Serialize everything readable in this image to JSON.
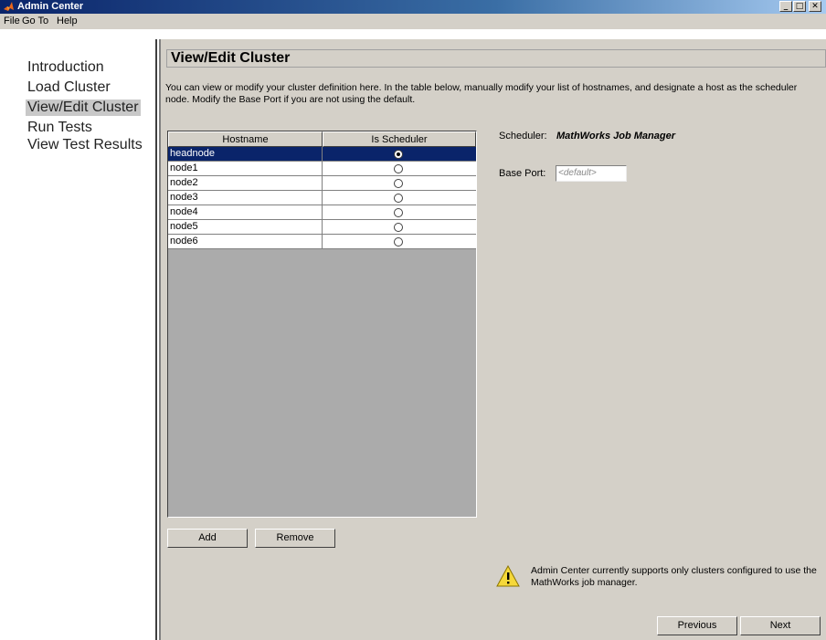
{
  "window": {
    "title": "Admin Center"
  },
  "menu": {
    "file": "File",
    "goto": "Go To",
    "help": "Help"
  },
  "nav": {
    "items": [
      {
        "label": "Introduction"
      },
      {
        "label": "Load Cluster"
      },
      {
        "label": "View/Edit Cluster",
        "active": true
      },
      {
        "label": "Run Tests"
      },
      {
        "label": "View Test Results"
      }
    ]
  },
  "page": {
    "title": "View/Edit Cluster",
    "description": "You can view or modify your cluster definition here. In the table below, manually modify your list of hostnames, and designate a host as the scheduler node. Modify the Base Port if you are not using the default."
  },
  "table": {
    "headers": {
      "hostname": "Hostname",
      "is_scheduler": "Is Scheduler"
    },
    "rows": [
      {
        "hostname": "headnode",
        "is_scheduler": true
      },
      {
        "hostname": "node1",
        "is_scheduler": false
      },
      {
        "hostname": "node2",
        "is_scheduler": false
      },
      {
        "hostname": "node3",
        "is_scheduler": false
      },
      {
        "hostname": "node4",
        "is_scheduler": false
      },
      {
        "hostname": "node5",
        "is_scheduler": false
      },
      {
        "hostname": "node6",
        "is_scheduler": false
      }
    ]
  },
  "buttons": {
    "add": "Add",
    "remove": "Remove",
    "previous": "Previous",
    "next": "Next"
  },
  "scheduler": {
    "label": "Scheduler:",
    "value": "MathWorks Job Manager"
  },
  "base_port": {
    "label": "Base Port:",
    "placeholder": "<default>"
  },
  "warning": {
    "icon": "warning-icon",
    "text": "Admin Center currently supports only clusters configured to use the MathWorks job manager."
  },
  "colors": {
    "title_bar": "#0a246a",
    "selected_row": "#0a246a",
    "panel": "#d4d0c8"
  }
}
